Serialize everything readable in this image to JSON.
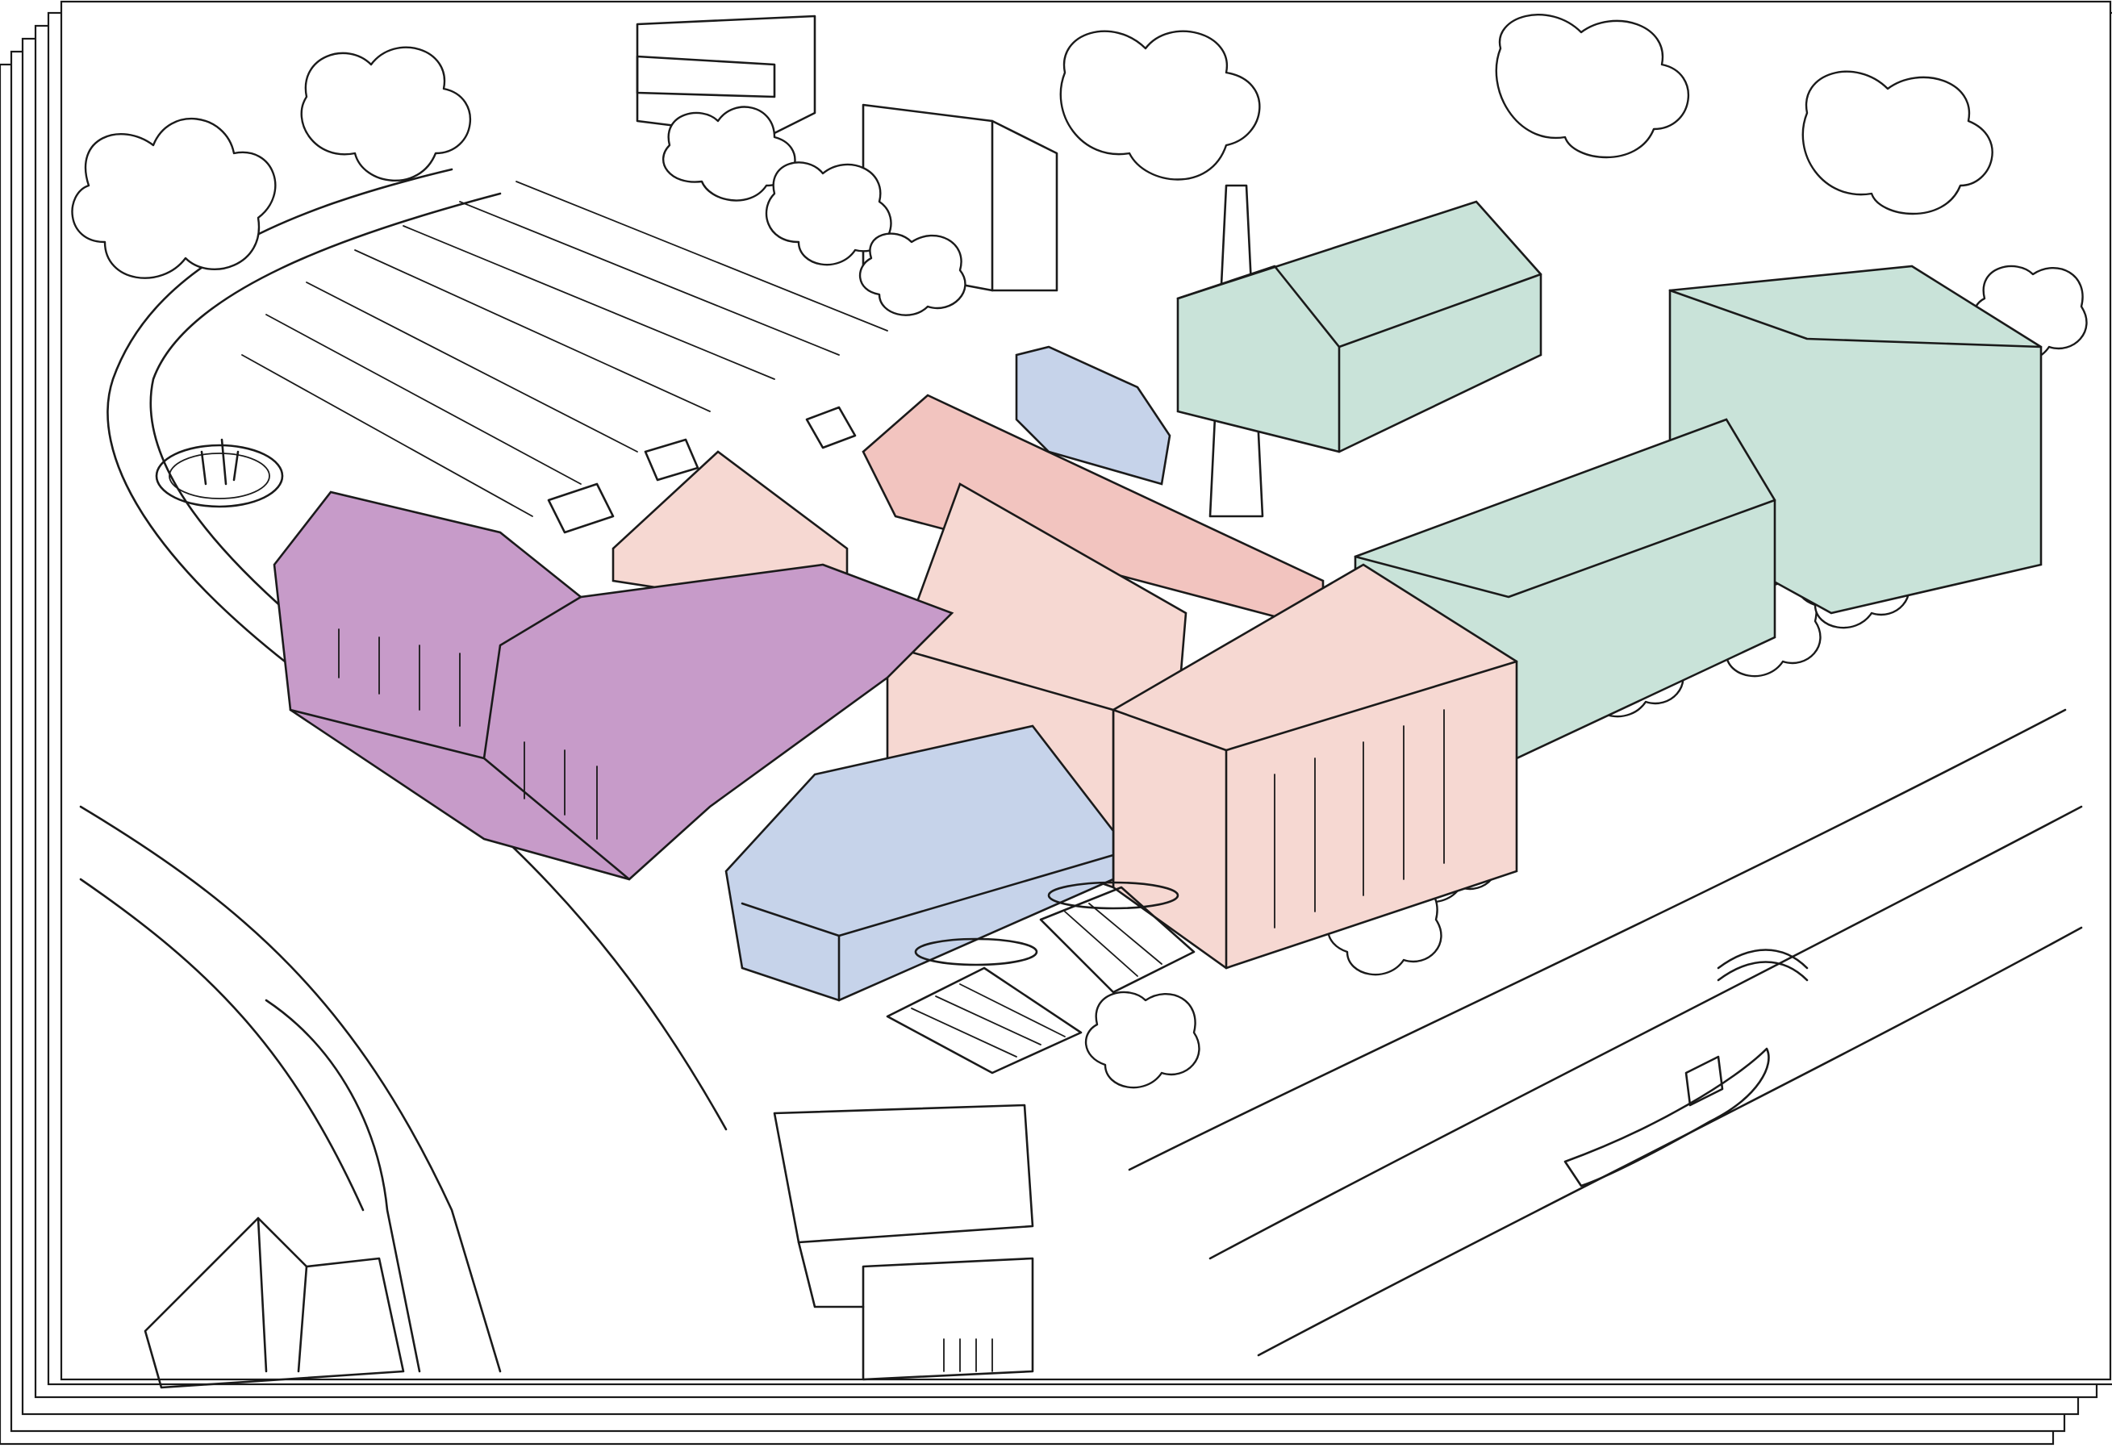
{
  "image": {
    "kind": "hand-drawn axonometric site sketch on stacked sheets",
    "sheet_count": 6
  },
  "colors": {
    "ink": "#1a1a1a",
    "paper": "#ffffff",
    "purple_buildings": "#c79bc9",
    "pink_buildings": "#f6d8d2",
    "salmon_roof": "#f2c4bf",
    "blue_buildings": "#c6d3ea",
    "green_buildings": "#c9e3d9"
  },
  "icons": [
    "chimney",
    "trees",
    "playground-fountain",
    "picnic-benches",
    "boat",
    "bridge"
  ]
}
